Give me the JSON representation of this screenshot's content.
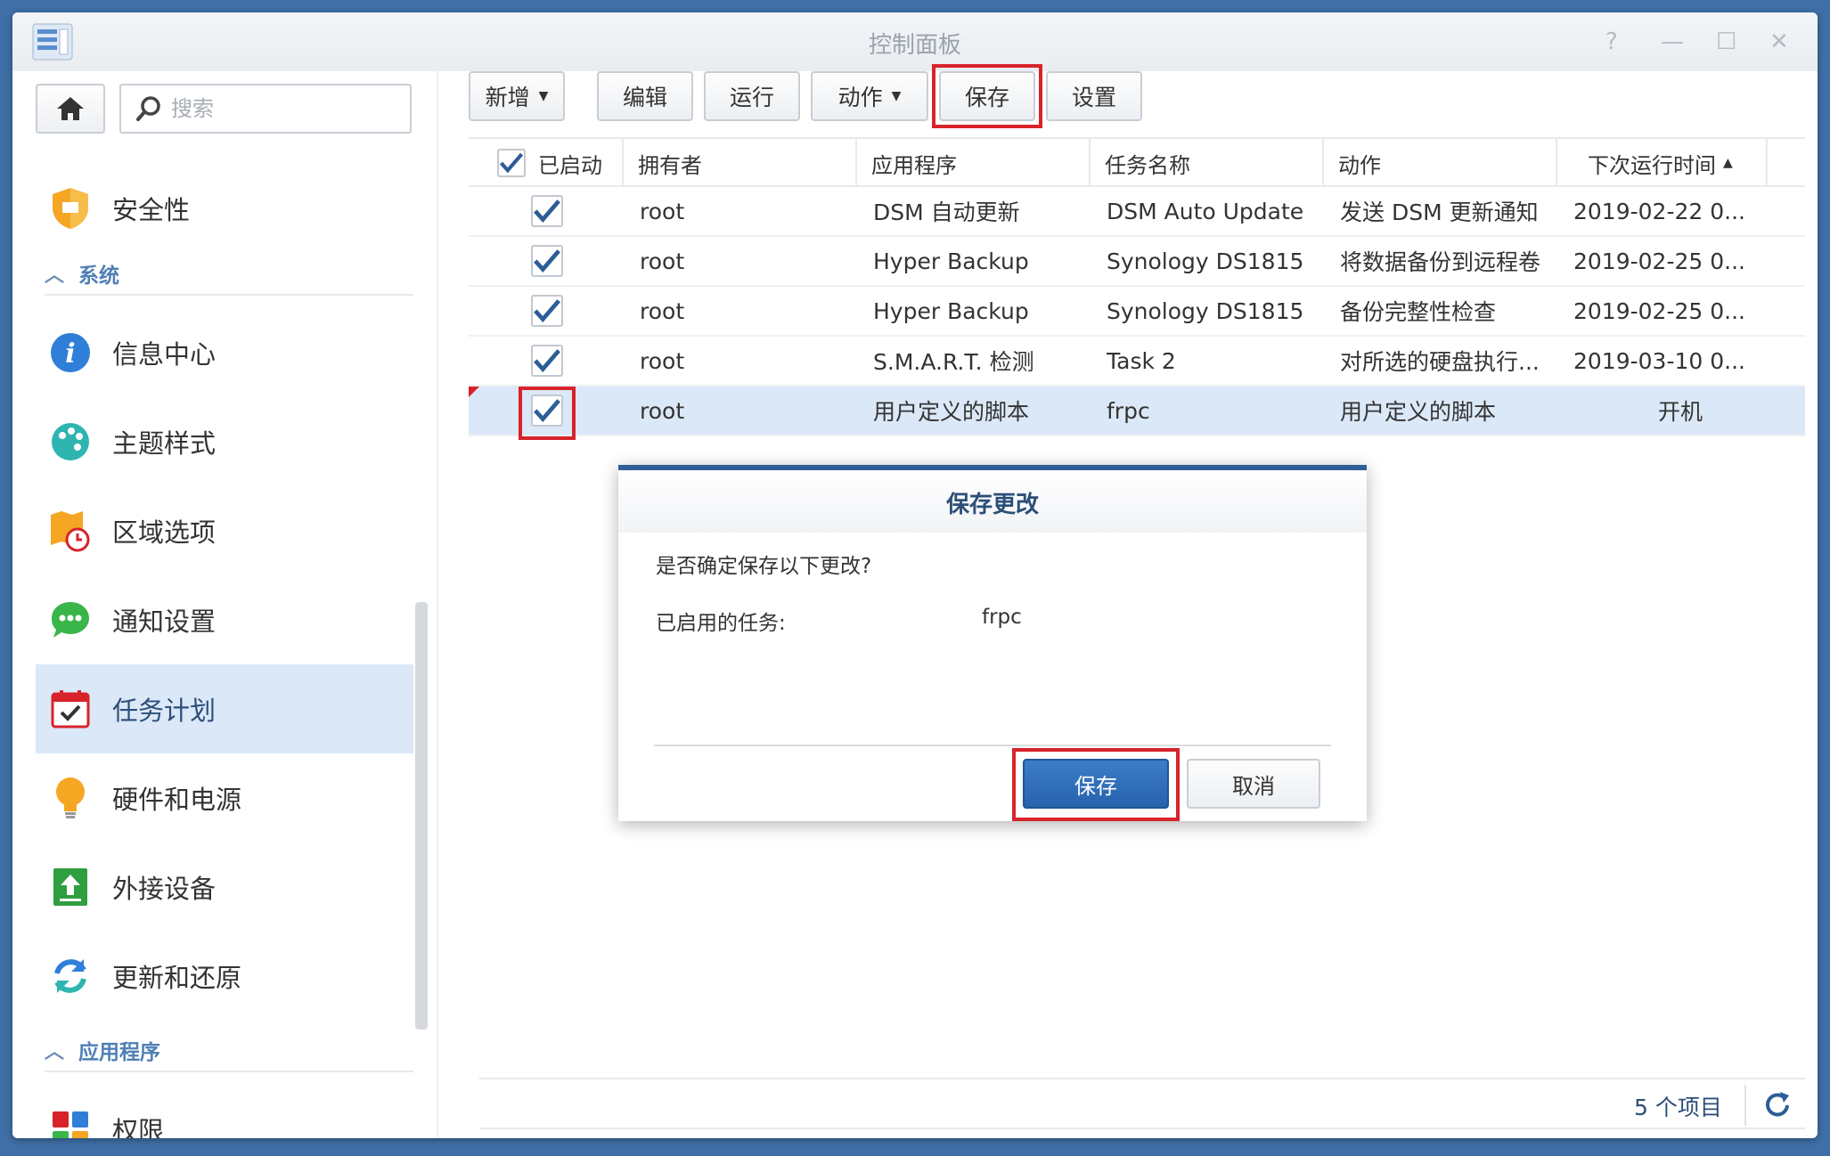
{
  "window": {
    "title": "控制面板"
  },
  "search": {
    "placeholder": "搜索"
  },
  "sidebar": {
    "items_top": [
      {
        "label": "安全性",
        "icon": "shield-icon"
      }
    ],
    "section_system": "系统",
    "items_system": [
      {
        "label": "信息中心",
        "icon": "info-icon"
      },
      {
        "label": "主题样式",
        "icon": "palette-icon"
      },
      {
        "label": "区域选项",
        "icon": "region-clock-icon"
      },
      {
        "label": "通知设置",
        "icon": "chat-bubble-icon"
      },
      {
        "label": "任务计划",
        "icon": "calendar-check-icon",
        "active": true
      },
      {
        "label": "硬件和电源",
        "icon": "lightbulb-icon"
      },
      {
        "label": "外接设备",
        "icon": "upload-device-icon"
      },
      {
        "label": "更新和还原",
        "icon": "refresh-arrows-icon"
      }
    ],
    "section_apps": "应用程序",
    "items_apps": [
      {
        "label": "权限",
        "icon": "apps-grid-icon"
      }
    ]
  },
  "toolbar": {
    "new": "新增",
    "edit": "编辑",
    "run": "运行",
    "action": "动作",
    "save": "保存",
    "settings": "设置"
  },
  "grid": {
    "columns": [
      "已启动",
      "拥有者",
      "应用程序",
      "任务名称",
      "动作",
      "下次运行时间"
    ],
    "rows": [
      {
        "enabled": true,
        "owner": "root",
        "app": "DSM 自动更新",
        "task": "DSM Auto Update",
        "action": "发送 DSM 更新通知",
        "next": "2019-02-22 0..."
      },
      {
        "enabled": true,
        "owner": "root",
        "app": "Hyper Backup",
        "task": "Synology DS1815",
        "action": "将数据备份到远程卷",
        "next": "2019-02-25 0..."
      },
      {
        "enabled": true,
        "owner": "root",
        "app": "Hyper Backup",
        "task": "Synology DS1815",
        "action": "备份完整性检查",
        "next": "2019-02-25 0..."
      },
      {
        "enabled": true,
        "owner": "root",
        "app": "S.M.A.R.T. 检测",
        "task": "Task 2",
        "action": "对所选的硬盘执行...",
        "next": "2019-03-10 0..."
      },
      {
        "enabled": true,
        "owner": "root",
        "app": "用户定义的脚本",
        "task": "frpc",
        "action": "用户定义的脚本",
        "next": "开机",
        "selected": true
      }
    ]
  },
  "dialog": {
    "title": "保存更改",
    "question": "是否确定保存以下更改?",
    "field_label": "已启用的任务:",
    "field_value": "frpc",
    "primary": "保存",
    "secondary": "取消"
  },
  "footer": {
    "count": "5 个项目"
  },
  "colors": {
    "accent": "#2763ad",
    "highlight": "#d8232a",
    "selected_row": "#dbe8f7"
  }
}
